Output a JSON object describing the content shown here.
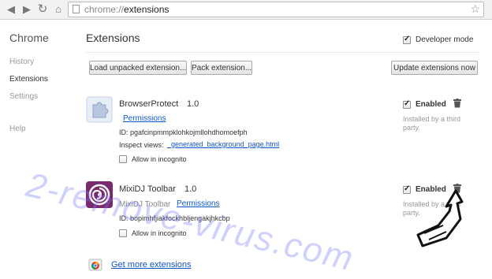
{
  "browser": {
    "url_scheme": "chrome://",
    "url_path": "extensions"
  },
  "sidebar": {
    "title": "Chrome",
    "items": [
      {
        "label": "History"
      },
      {
        "label": "Extensions"
      },
      {
        "label": "Settings"
      },
      {
        "label": "Help"
      }
    ]
  },
  "main": {
    "title": "Extensions",
    "developer_mode_label": "Developer mode",
    "developer_mode_checked": true,
    "buttons": {
      "load_unpacked": "Load unpacked extension...",
      "pack": "Pack extension...",
      "update": "Update extensions now"
    }
  },
  "extensions": [
    {
      "name": "BrowserProtect",
      "version": "1.0",
      "permissions": "Permissions",
      "id_label": "ID:",
      "id": "pgafcinpmmpklohkojmllohdhomoefph",
      "inspect_label": "Inspect views:",
      "inspect_link": "_generated_background_page.html",
      "incognito": "Allow in incognito",
      "enabled": "Enabled",
      "note": "Installed by a third party."
    },
    {
      "name": "MixiDJ Toolbar",
      "version": "1.0",
      "desc": "MixiDJ Toolbar",
      "permissions": "Permissions",
      "id_label": "ID:",
      "id": "bopimhfjiakfockhbljengakjhkcbp",
      "incognito": "Allow in incognito",
      "enabled": "Enabled",
      "note": "Installed by a third party."
    }
  ],
  "footer": {
    "get_more": "Get more extensions"
  },
  "watermark": "2-remove-virus.com"
}
